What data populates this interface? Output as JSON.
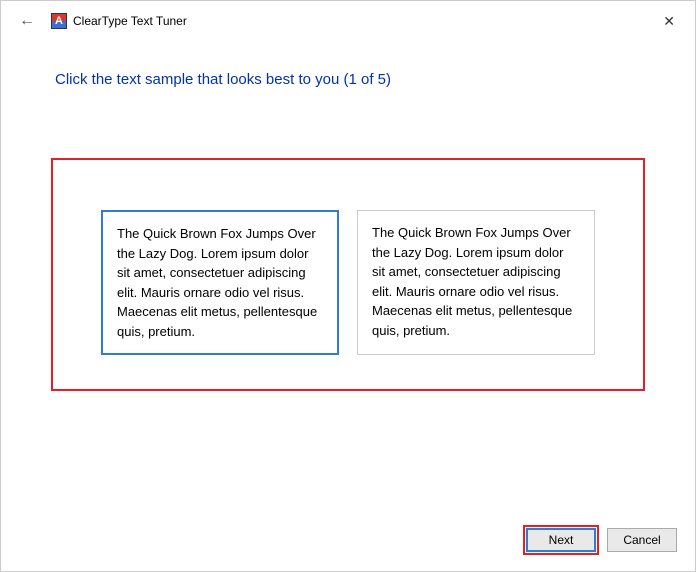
{
  "titlebar": {
    "title": "ClearType Text Tuner"
  },
  "heading": "Click the text sample that looks best to you (1 of 5)",
  "samples": {
    "left": "The Quick Brown Fox Jumps Over the Lazy Dog. Lorem ipsum dolor sit amet, consectetuer adipiscing elit. Mauris ornare odio vel risus. Maecenas elit metus, pellentesque quis, pretium.",
    "right": "The Quick Brown Fox Jumps Over the Lazy Dog. Lorem ipsum dolor sit amet, consectetuer adipiscing elit. Mauris ornare odio vel risus. Maecenas elit metus, pellentesque quis, pretium."
  },
  "buttons": {
    "next": "Next",
    "cancel": "Cancel"
  }
}
